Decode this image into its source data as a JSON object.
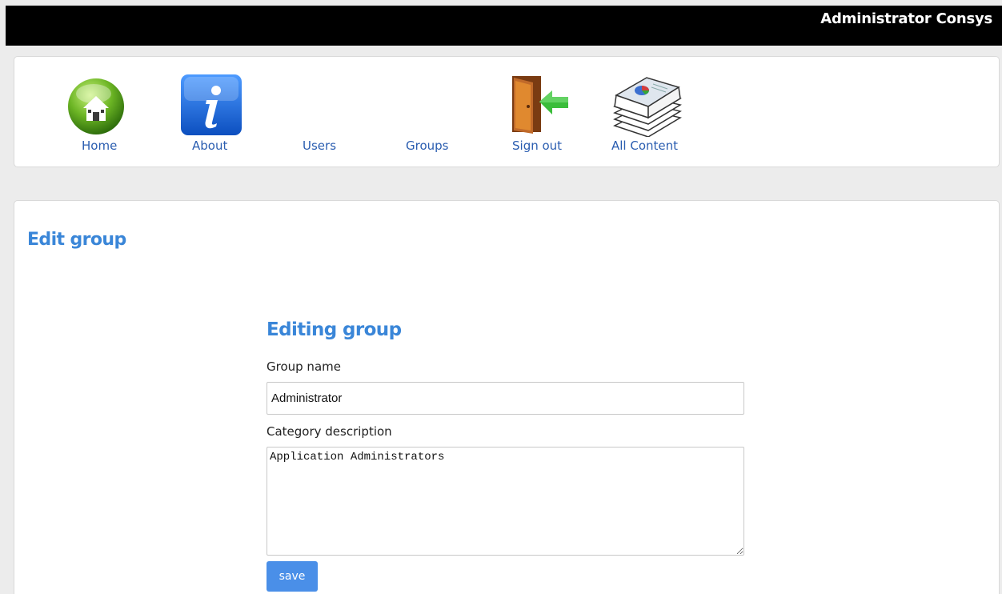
{
  "header": {
    "user_name": "Administrator Consys"
  },
  "nav": {
    "items": [
      {
        "label": "Home",
        "icon": "home-icon"
      },
      {
        "label": "About",
        "icon": "info-icon"
      },
      {
        "label": "Users",
        "icon": ""
      },
      {
        "label": "Groups",
        "icon": ""
      },
      {
        "label": "Sign out",
        "icon": "sign-out-door-icon"
      },
      {
        "label": "All Content",
        "icon": "documents-stack-icon"
      }
    ]
  },
  "page": {
    "title": "Edit group"
  },
  "form": {
    "heading": "Editing group",
    "group_name_label": "Group name",
    "group_name_value": "Administrator",
    "description_label": "Category description",
    "description_value": "Application Administrators",
    "save_label": "save"
  },
  "colors": {
    "accent": "#3a86d8",
    "nav_link": "#2a5db0",
    "button": "#4a8fe8",
    "topbar": "#000000"
  }
}
